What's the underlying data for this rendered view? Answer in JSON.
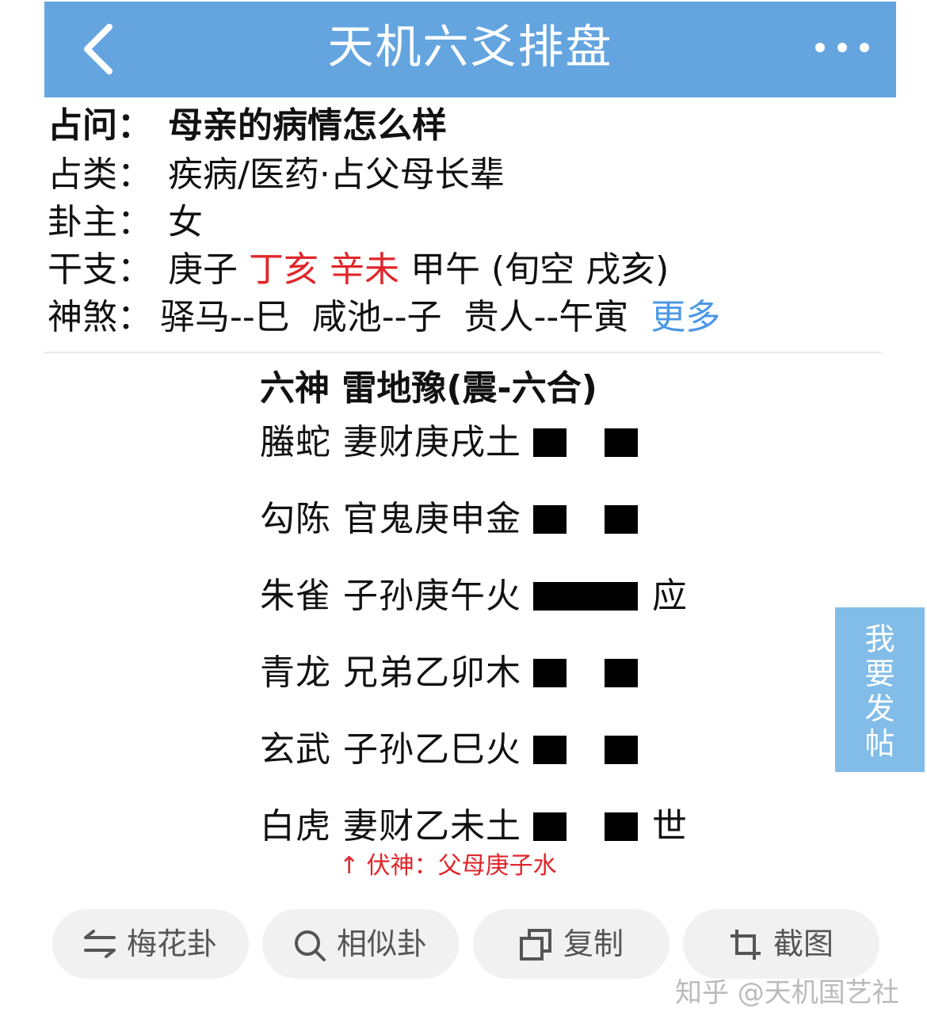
{
  "header": {
    "title": "天机六爻排盘",
    "back_icon": "chevron-left-icon",
    "more_icon": "more-dots-icon",
    "bg_color": "#64a5e0"
  },
  "info": {
    "question": {
      "label": "占问：",
      "value": "母亲的病情怎么样"
    },
    "category": {
      "label": "占类：",
      "value": "疾病/医药·占父母长辈"
    },
    "owner": {
      "label": "卦主：",
      "value": "女"
    },
    "ganzhi": {
      "label": "干支：",
      "year": "庚子",
      "month": "丁亥",
      "day": "辛未",
      "hour": "甲午",
      "xunkong": "(旬空 戌亥)"
    },
    "shensha": {
      "label": "神煞：",
      "items": [
        "驿马--巳",
        "咸池--子",
        "贵人--午寅"
      ],
      "more": "更多"
    }
  },
  "hexagram": {
    "title": "六神  雷地豫(震-六合)",
    "lines": [
      {
        "label": "螣蛇 妻财庚戌土",
        "yin": true,
        "mark": ""
      },
      {
        "label": "勾陈 官鬼庚申金",
        "yin": true,
        "mark": ""
      },
      {
        "label": "朱雀 子孙庚午火",
        "yin": false,
        "mark": "应"
      },
      {
        "label": "青龙 兄弟乙卯木",
        "yin": true,
        "mark": ""
      },
      {
        "label": "玄武 子孙乙巳火",
        "yin": true,
        "mark": ""
      },
      {
        "label": "白虎 妻财乙未土",
        "yin": true,
        "mark": "世"
      }
    ],
    "fushen": "↑ 伏神：父母庚子水"
  },
  "side_button": {
    "label": "我要发帖"
  },
  "toolbar": [
    {
      "label": "梅花卦",
      "icon": "swap-icon"
    },
    {
      "label": "相似卦",
      "icon": "search-icon"
    },
    {
      "label": "复制",
      "icon": "copy-icon"
    },
    {
      "label": "截图",
      "icon": "crop-icon"
    }
  ],
  "watermark": "知乎 @天机国艺社"
}
